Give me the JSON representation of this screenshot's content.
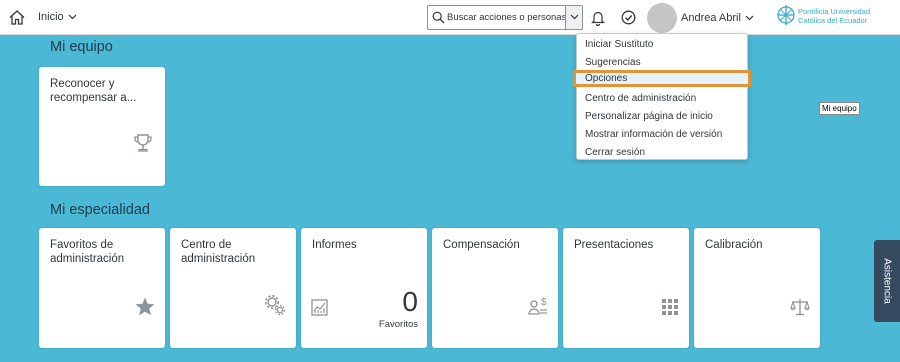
{
  "header": {
    "nav_label": "Inicio",
    "search_placeholder": "Buscar acciones o personas",
    "user_name": "Andrea Abril",
    "logo_line1": "Pontificia Universidad",
    "logo_line2": "Católica del Ecuador",
    "icons": [
      "home-icon",
      "chevron-down-icon",
      "search-icon",
      "bell-icon",
      "check-circle-icon",
      "avatar"
    ]
  },
  "sections": {
    "team_title": "Mi equipo",
    "specialty_title": "Mi especialidad"
  },
  "team_tiles": [
    {
      "title": "Reconocer y recompensar a...",
      "icon": "trophy-icon"
    }
  ],
  "specialty_tiles": [
    {
      "title": "Favoritos de administración",
      "icon": "star-icon"
    },
    {
      "title": "Centro de administración",
      "icon": "gears-icon"
    },
    {
      "title": "Informes",
      "icon": "report-icon",
      "kpi_value": "0",
      "kpi_label": "Favoritos"
    },
    {
      "title": "Compensación",
      "icon": "person-dollar-icon"
    },
    {
      "title": "Presentaciones",
      "icon": "grid-icon"
    },
    {
      "title": "Calibración",
      "icon": "scale-icon"
    }
  ],
  "user_menu": {
    "items": [
      "Iniciar Sustituto",
      "Sugerencias",
      "Opciones",
      "Centro de administración",
      "Personalizar página de inicio",
      "Mostrar información de versión",
      "Cerrar sesión"
    ],
    "active_item": "Opciones"
  },
  "tooltip_text": "Mi equipo",
  "side_tab_label": "Asistencia",
  "colors": {
    "background": "#4bb8d5",
    "highlight_outline": "#e49334",
    "side_tab": "#354a5f",
    "logo": "#3aa9cc"
  }
}
